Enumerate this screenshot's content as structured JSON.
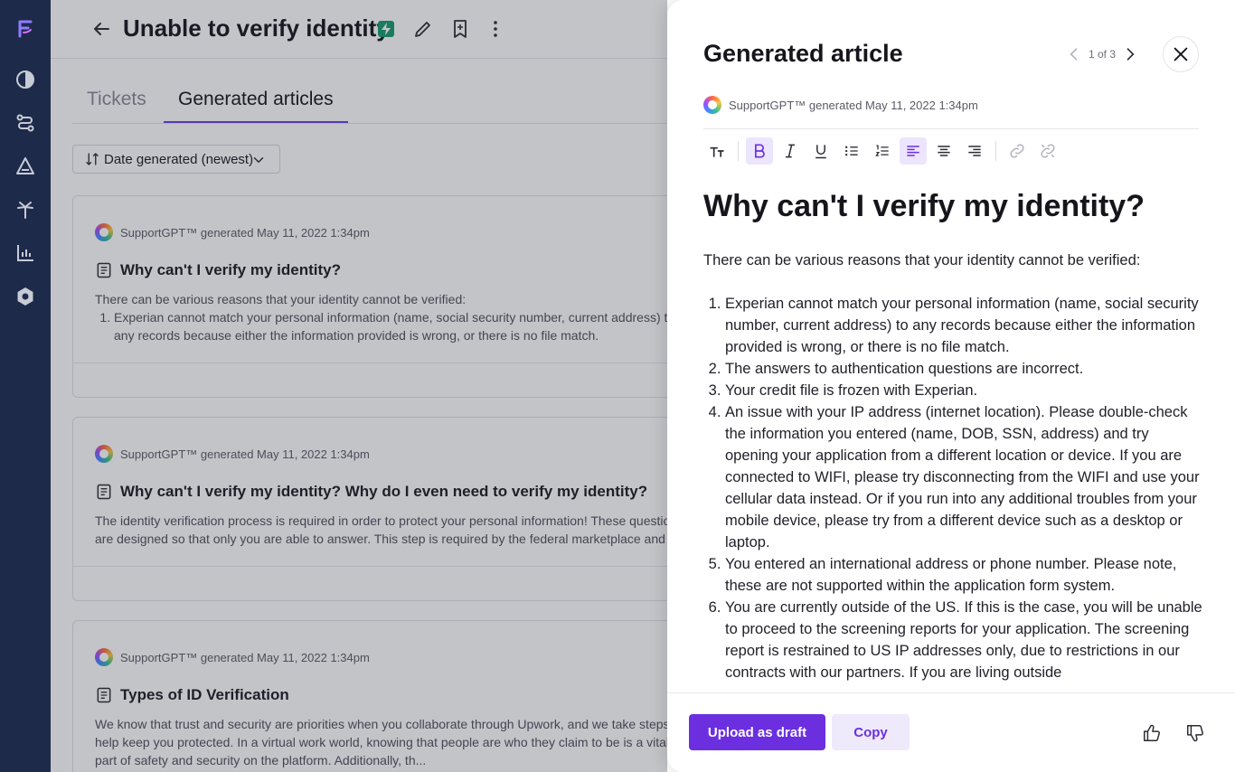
{
  "header": {
    "title": "Unable to verify identity"
  },
  "tabs": [
    {
      "label": "Tickets"
    },
    {
      "label": "Generated articles"
    }
  ],
  "sort": {
    "label": "Date generated (newest)"
  },
  "cards": [
    {
      "meta": "SupportGPT™ generated May 11, 2022 1:34pm",
      "title": "Why can't I verify my identity?",
      "intro": "There can be various reasons that your identity cannot be verified:",
      "item1": "Experian cannot match your personal information (name, social security number, current address) to any records because either the information provided is wrong, or there is no file match."
    },
    {
      "meta": "SupportGPT™ generated May 11, 2022 1:34pm",
      "title": "Why can't I verify my identity? Why do I even need to verify my identity?",
      "body": "The identity verification process is required in order to protect your personal information! These questions are designed so that only you are able to answer. This step is required by the federal marketplace and ensures that no one else applies for health coverage using your identity."
    },
    {
      "meta": "SupportGPT™ generated May 11, 2022 1:34pm",
      "title": "Types of ID Verification",
      "body": "We know that trust and security are priorities when you collaborate through Upwork, and we take steps to help keep you protected. In a virtual work world, knowing that people are who they claim to be is a vital part of safety and security on the platform. Additionally, th..."
    }
  ],
  "panel": {
    "title": "Generated article",
    "pager": "1 of 3",
    "meta": "SupportGPT™ generated May 11, 2022 1:34pm",
    "article": {
      "heading": "Why can't I verify my identity?",
      "intro": "There can be various reasons that your identity cannot be verified:",
      "items": [
        "Experian cannot match your personal information (name, social security number, current address) to any records because either the information provided is wrong, or there is no file match.",
        "The answers to authentication questions are incorrect.",
        "Your credit file is frozen with Experian.",
        "An issue with your IP address (internet location). Please double-check the information you entered (name, DOB, SSN, address) and try opening your application from a different location or device. If you are connected to WIFI, please try disconnecting from the WIFI and use your cellular data instead. Or if you run into any additional troubles from your mobile device, please try from a different device such as a desktop or laptop.",
        "You entered an international address or phone number. Please note, these are not supported within the application form system.",
        "You are currently outside of the US. If this is the case, you will be unable to proceed to the screening reports for your application. The screening report is restrained to US IP addresses only, due to restrictions in our contracts with our partners. If you are living outside"
      ]
    },
    "actions": {
      "upload": "Upload as draft",
      "copy": "Copy"
    }
  },
  "colors": {
    "accent": "#6b2fe0",
    "rail": "#1e2a4a",
    "bolt": "#179b6b"
  }
}
